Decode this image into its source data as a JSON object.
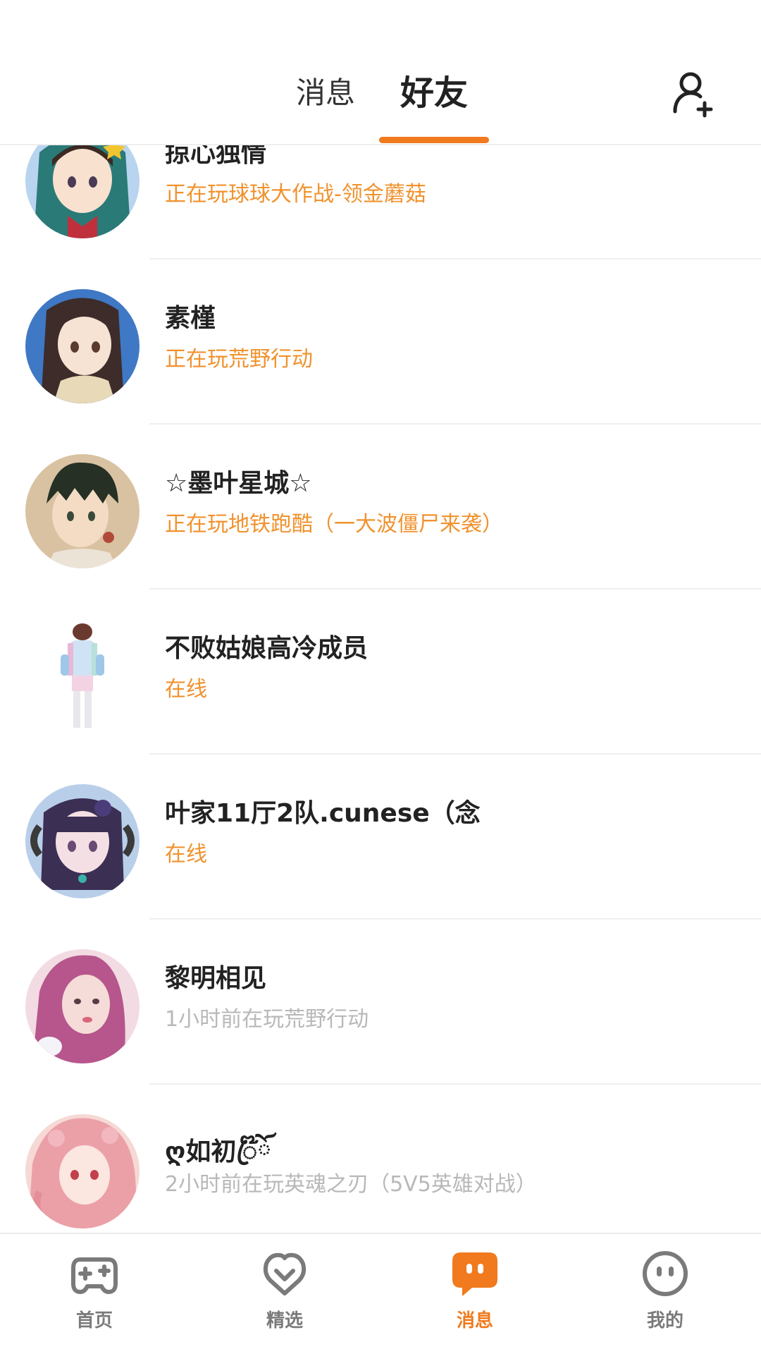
{
  "header": {
    "tabs": [
      {
        "label": "消息",
        "active": false
      },
      {
        "label": "好友",
        "active": true
      }
    ],
    "add_friend_icon": "add-user-icon",
    "accent_color": "#f07a1d"
  },
  "friends": [
    {
      "name": "掠心独情",
      "status": "正在玩球球大作战-领金蘑菇",
      "status_type": "playing"
    },
    {
      "name": "素槿",
      "status": "正在玩荒野行动",
      "status_type": "playing"
    },
    {
      "name": "☆墨叶星城☆",
      "status": "正在玩地铁跑酷（一大波僵尸来袭）",
      "status_type": "playing"
    },
    {
      "name": "不败姑娘高冷成员",
      "status": "在线",
      "status_type": "online"
    },
    {
      "name": "叶家11厅2队.cunese（念",
      "status": "在线",
      "status_type": "online"
    },
    {
      "name": "黎明相见",
      "status": "1小时前在玩荒野行动",
      "status_type": "offline"
    },
    {
      "name": "ღ如初ꦿ໊ོ",
      "status": "2小时前在玩英魂之刃（5V5英雄对战）",
      "status_type": "offline"
    }
  ],
  "bottom_nav": [
    {
      "label": "首页",
      "icon": "gamepad-icon",
      "active": false
    },
    {
      "label": "精选",
      "icon": "heart-chat-icon",
      "active": false
    },
    {
      "label": "消息",
      "icon": "message-bubble-icon",
      "active": true
    },
    {
      "label": "我的",
      "icon": "face-icon",
      "active": false
    }
  ],
  "colors": {
    "status_active": "#f0922e",
    "status_idle": "#b8b8b8",
    "nav_inactive": "#7a7a7a"
  }
}
